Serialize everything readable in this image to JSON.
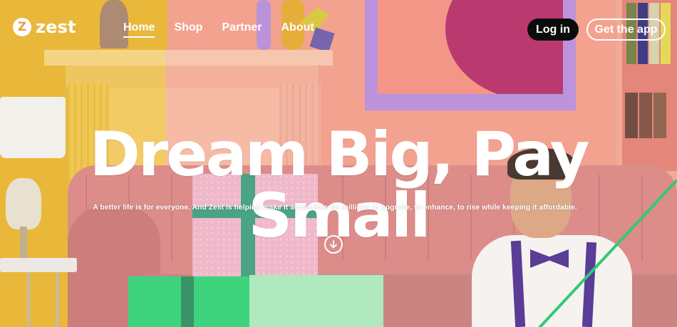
{
  "brand": {
    "logo_glyph": "Z",
    "name": "zest"
  },
  "nav": {
    "items": [
      {
        "label": "Home",
        "active": true
      },
      {
        "label": "Shop",
        "active": false
      },
      {
        "label": "Partner",
        "active": false
      },
      {
        "label": "About",
        "active": false
      }
    ]
  },
  "header_actions": {
    "login_label": "Log in",
    "get_app_label": "Get the app"
  },
  "hero": {
    "headline": "Dream Big, Pay Small",
    "subtext": "A better life is for everyone. And Zest is helping make it accessible for millions to upgrade, to enhance, to rise while keeping it affordable.",
    "scroll_icon": "arrow-down-circle-icon"
  },
  "colors": {
    "login_bg": "#0c0c0c",
    "text": "#ffffff",
    "accent_green": "#22c46a"
  }
}
